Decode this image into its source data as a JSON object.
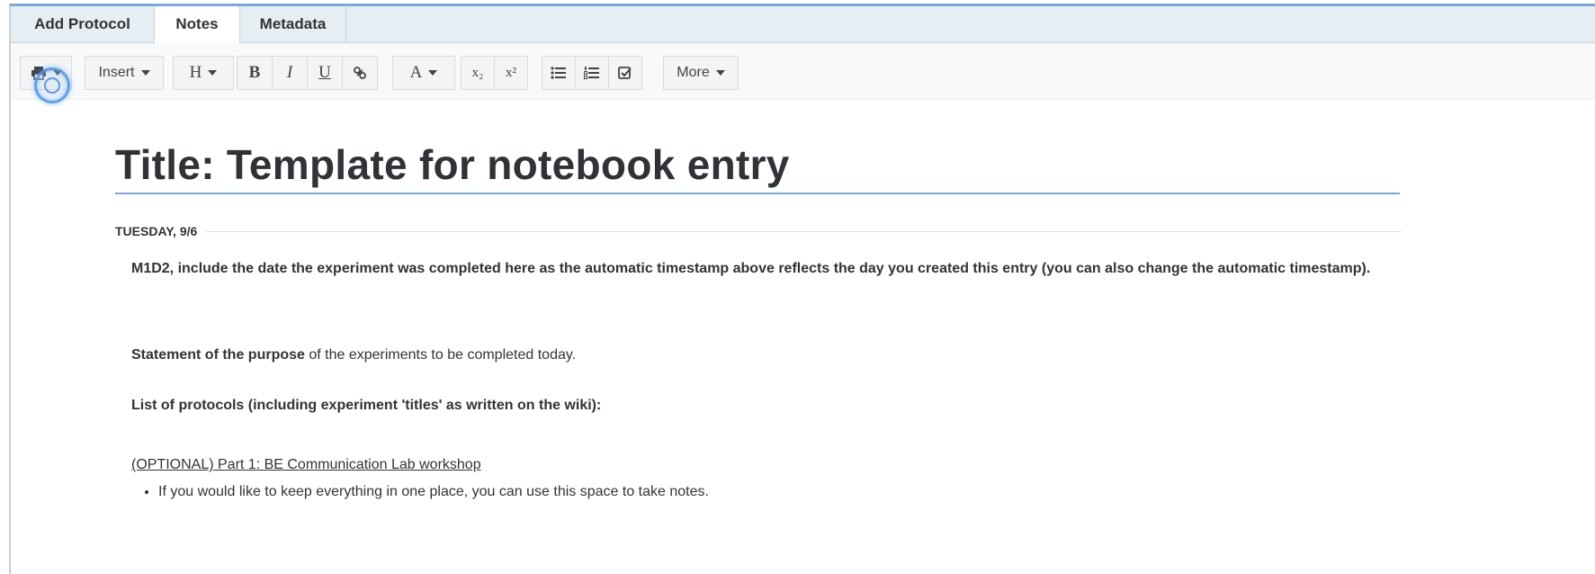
{
  "tabs": [
    {
      "label": "Add Protocol",
      "active": false
    },
    {
      "label": "Notes",
      "active": true
    },
    {
      "label": "Metadata",
      "active": false
    }
  ],
  "toolbar": {
    "print_icon": "print-icon",
    "insert_label": "Insert",
    "heading_label": "H",
    "bold_label": "B",
    "italic_label": "I",
    "underline_label": "U",
    "link_icon": "link-icon",
    "font_color_label": "A",
    "subscript_label": "x₂",
    "superscript_label": "x²",
    "bullet_list_icon": "bullet-list-icon",
    "numbered_list_icon": "numbered-list-icon",
    "checklist_icon": "checklist-icon",
    "more_label": "More"
  },
  "entry": {
    "title": "Title: Template for notebook entry",
    "date_label": "TUESDAY, 9/6",
    "para1": "M1D2, include the date the experiment was completed here as the automatic timestamp above reflects the day you created this entry (you can also change the automatic timestamp).",
    "para2_bold": "Statement of the purpose",
    "para2_rest": " of the experiments to be completed today.",
    "para3": "List of protocols (including experiment 'titles' as written on the wiki):",
    "part1": "(OPTIONAL) Part 1: BE Communication Lab workshop",
    "bullets": [
      "If you would like to keep everything in one place, you can use this space to take notes."
    ]
  },
  "colors": {
    "accent_blue": "#7aa7de",
    "tab_bar_bg": "#e6eef3",
    "toolbar_bg": "#f7f9fa"
  }
}
